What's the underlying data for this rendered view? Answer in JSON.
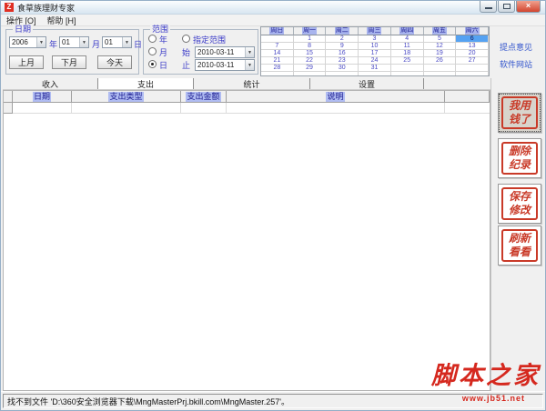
{
  "window": {
    "title": "食草族理财专家",
    "logo": "Z"
  },
  "icons": {
    "dropdown": "▼",
    "close": "×"
  },
  "menu": {
    "items": [
      {
        "label": "操作 [O]"
      },
      {
        "label": "帮助 [H]"
      }
    ]
  },
  "date_box": {
    "label": "日期",
    "year": "2006",
    "year_unit": "年",
    "month": "01",
    "month_unit": "月",
    "day": "01",
    "day_unit": "日",
    "prev_month": "上月",
    "next_month": "下月",
    "today": "今天"
  },
  "range_box": {
    "label": "范围",
    "year_option": "年",
    "custom_option": "指定范围",
    "month_option": "月",
    "day_option": "日",
    "start_label": "始",
    "start_date": "2010-03-11",
    "end_label": "止",
    "end_date": "2010-03-11",
    "selected_option": "日"
  },
  "calendar": {
    "headers": [
      "周日",
      "周一",
      "周二",
      "周三",
      "周四",
      "周五",
      "周六"
    ],
    "rows": [
      [
        "",
        "1",
        "2",
        "3",
        "4",
        "5",
        "6"
      ],
      [
        "7",
        "8",
        "9",
        "10",
        "11",
        "12",
        "13"
      ],
      [
        "14",
        "15",
        "16",
        "17",
        "18",
        "19",
        "20"
      ],
      [
        "21",
        "22",
        "23",
        "24",
        "25",
        "26",
        "27"
      ],
      [
        "28",
        "29",
        "30",
        "31",
        "",
        "",
        ""
      ],
      [
        "",
        "",
        "",
        "",
        "",
        "",
        ""
      ]
    ],
    "selected_day": "6"
  },
  "links": {
    "feedback": "提点意见",
    "website": "软件网站"
  },
  "tabs": [
    {
      "label": "收入",
      "active": false
    },
    {
      "label": "支出",
      "active": true
    },
    {
      "label": "统计",
      "active": false
    },
    {
      "label": "设置",
      "active": false
    }
  ],
  "table": {
    "columns": [
      "日期",
      "支出类型",
      "支出金额",
      "说明"
    ]
  },
  "actions": [
    {
      "id": "spend-money",
      "line1": "我用",
      "line2": "钱了",
      "full": "我用钱了"
    },
    {
      "id": "delete-record",
      "line1": "删除",
      "line2": "纪录",
      "full": "删除纪录"
    },
    {
      "id": "save-changes",
      "line1": "保存",
      "line2": "修改",
      "full": "保存修改"
    },
    {
      "id": "refresh-view",
      "line1": "刷新",
      "line2": "看看",
      "full": "刷新看看"
    }
  ],
  "watermark": {
    "title": "脚本之家",
    "url": "www.jb51.net"
  },
  "statusbar": {
    "text": "找不到文件 'D:\\360安全浏览器下载\\MngMasterPrj.bkill.com\\MngMaster.257'。"
  },
  "colors": {
    "accent_blue_label": "#3a3ac8",
    "header_highlight": "#a8b4ee",
    "selected_day_bg": "#55a2f2",
    "seal_red": "#c93a28",
    "watermark_red": "#d5281e",
    "link_blue": "#3355cc",
    "close_button_red": "#d2452f"
  }
}
